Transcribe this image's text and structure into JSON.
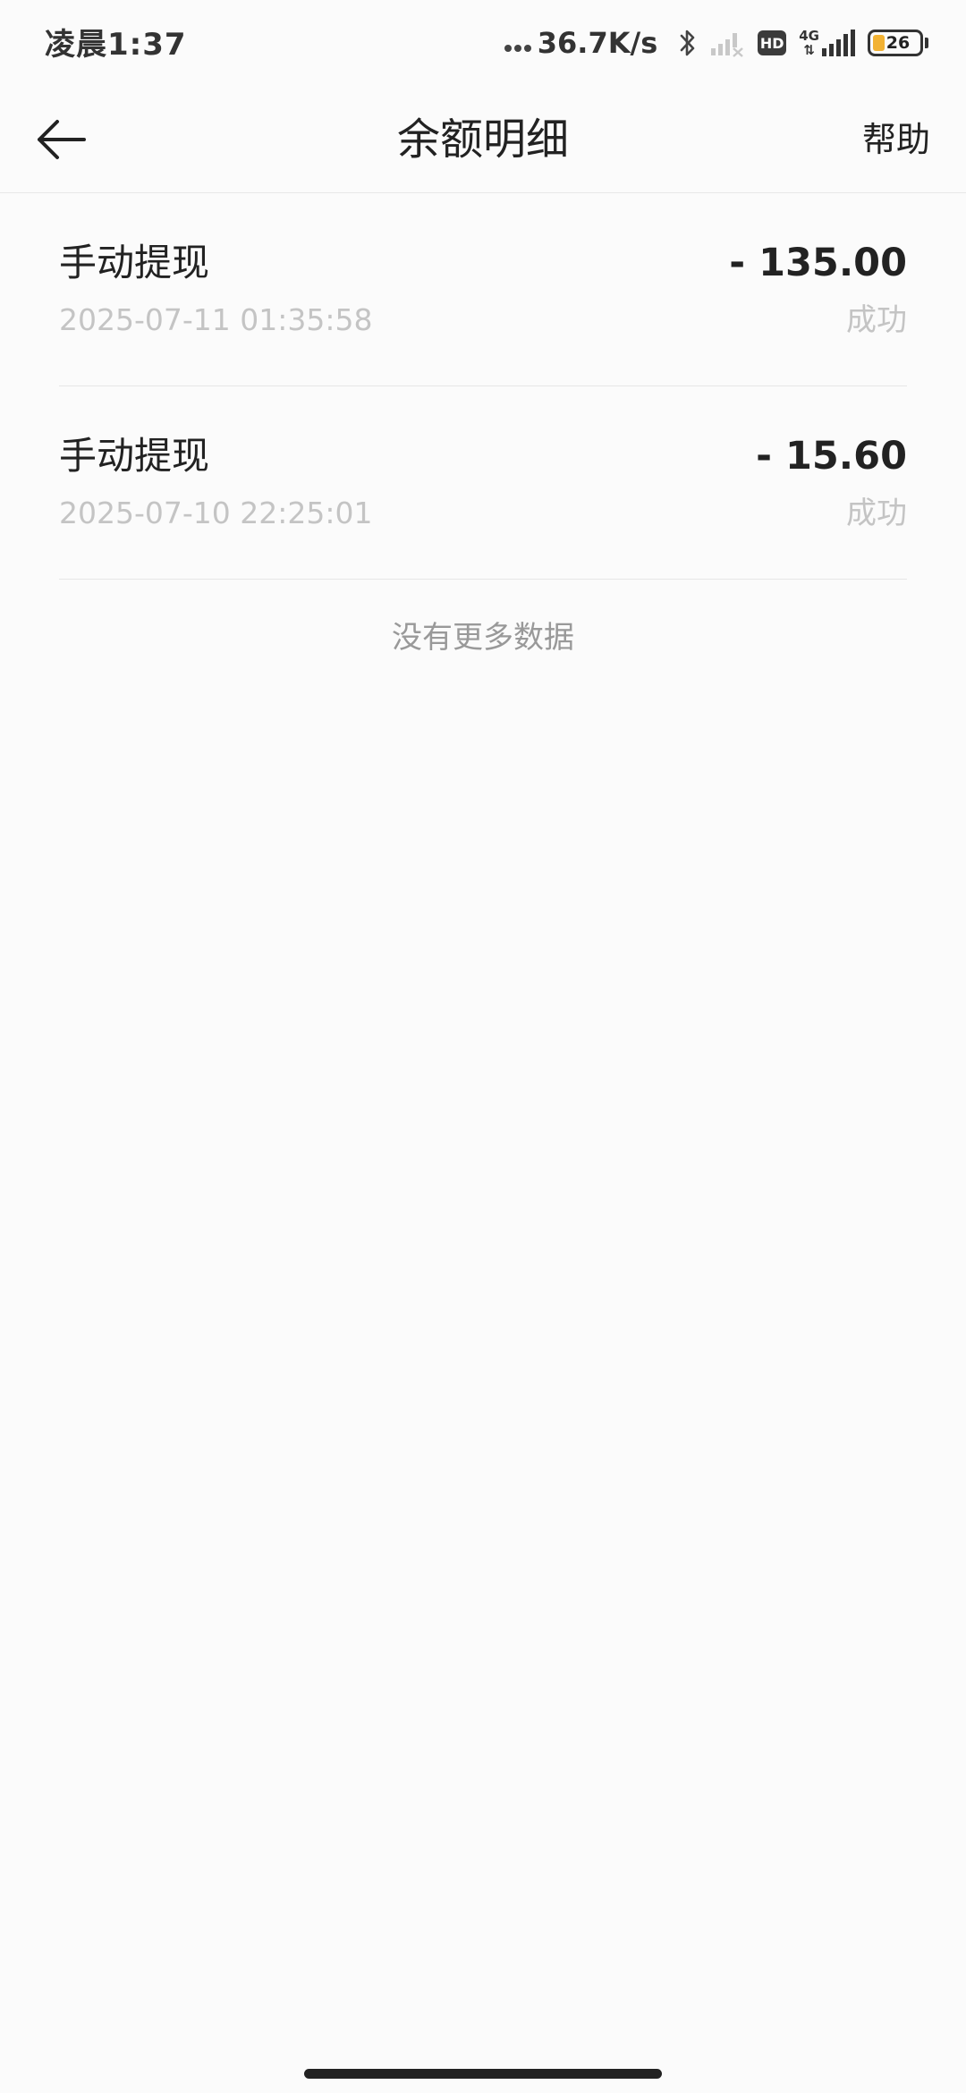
{
  "status_bar": {
    "time": "凌晨1:37",
    "net_speed": "36.7K/s",
    "hd_badge": "HD",
    "net_type": "4G",
    "battery_level": "26",
    "battery_color": "#f2b233"
  },
  "nav": {
    "title": "余额明细",
    "help_label": "帮助",
    "back_icon": "arrow-left-icon"
  },
  "records": [
    {
      "title": "手动提现",
      "time": "2025-07-11 01:35:58",
      "amount": "- 135.00",
      "status": "成功"
    },
    {
      "title": "手动提现",
      "time": "2025-07-10 22:25:01",
      "amount": "- 15.60",
      "status": "成功"
    }
  ],
  "footer_text": "没有更多数据"
}
